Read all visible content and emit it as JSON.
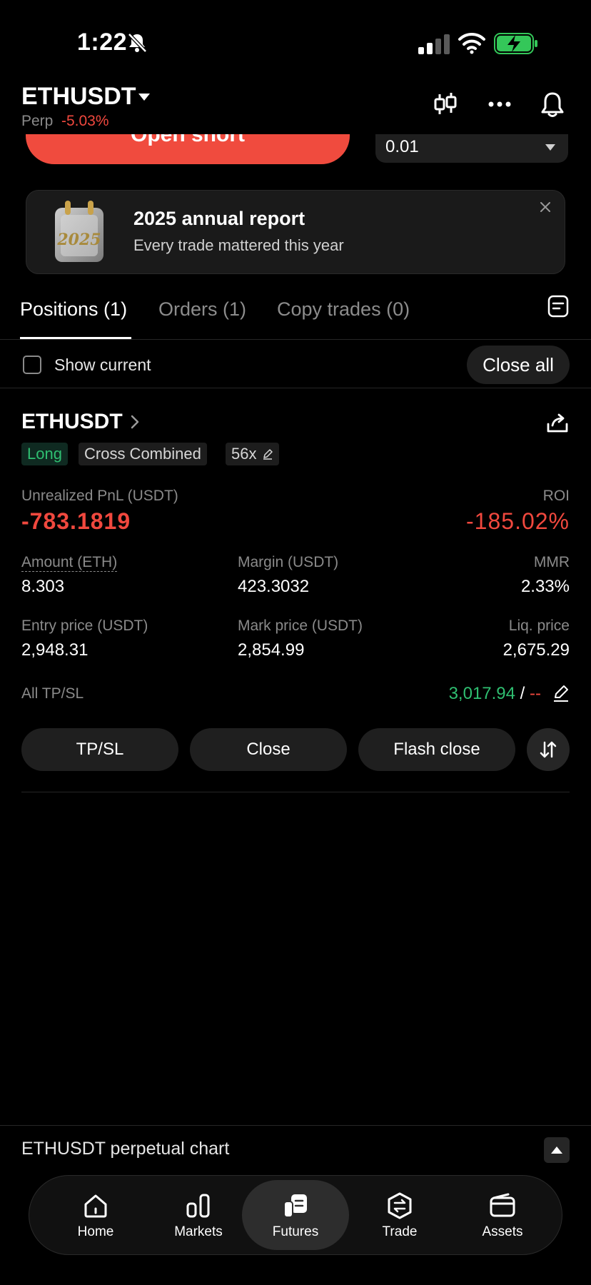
{
  "status": {
    "time": "1:22"
  },
  "header": {
    "symbol": "ETHUSDT",
    "perp_label": "Perp",
    "change": "-5.03%"
  },
  "trade_panel": {
    "open_short_label": "Open short",
    "quantity": "0.01"
  },
  "banner": {
    "title": "2025 annual report",
    "subtitle": "Every trade mattered this year",
    "image_text": "2025"
  },
  "tabs": [
    {
      "label": "Positions (1)"
    },
    {
      "label": "Orders (1)"
    },
    {
      "label": "Copy trades (0)"
    }
  ],
  "filter": {
    "show_current": "Show current",
    "close_all": "Close all"
  },
  "position": {
    "symbol": "ETHUSDT",
    "side": "Long",
    "margin_mode": "Cross Combined",
    "leverage": "56x",
    "unrealized_label": "Unrealized PnL (USDT)",
    "unrealized_value": "-783.1819",
    "roi_label": "ROI",
    "roi_value": "-185.02%",
    "amount_label": "Amount (ETH)",
    "amount_value": "8.303",
    "margin_label": "Margin (USDT)",
    "margin_value": "423.3032",
    "mmr_label": "MMR",
    "mmr_value": "2.33%",
    "entry_label": "Entry price (USDT)",
    "entry_value": "2,948.31",
    "mark_label": "Mark price (USDT)",
    "mark_value": "2,854.99",
    "liq_label": "Liq. price",
    "liq_value": "2,675.29",
    "tpsl_label": "All TP/SL",
    "tp_value": "3,017.94",
    "tpsl_sep": "/",
    "sl_value": "--",
    "btn_tpsl": "TP/SL",
    "btn_close": "Close",
    "btn_flash": "Flash close"
  },
  "chart_bar": {
    "title": "ETHUSDT perpetual chart"
  },
  "nav": [
    {
      "label": "Home",
      "icon": "home-icon"
    },
    {
      "label": "Markets",
      "icon": "markets-icon"
    },
    {
      "label": "Futures",
      "icon": "futures-icon"
    },
    {
      "label": "Trade",
      "icon": "trade-icon"
    },
    {
      "label": "Assets",
      "icon": "wallet-icon"
    }
  ],
  "colors": {
    "red": "#f0483e",
    "green": "#2fbf71",
    "battery": "#34c759"
  }
}
